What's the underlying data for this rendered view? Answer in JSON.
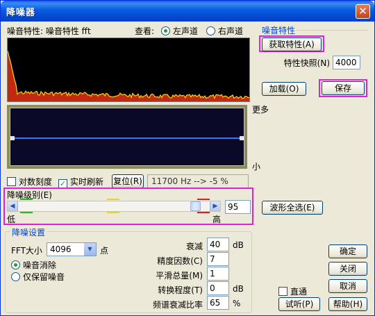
{
  "window": {
    "title": "降噪器",
    "close_glyph": "✕"
  },
  "noise_profile_header": {
    "label": "噪音特性: 噪音特性 fft"
  },
  "view": {
    "label": "查看:",
    "left_channel": "左声道",
    "right_channel": "右声道",
    "selected": "左声道"
  },
  "profile_group": {
    "title": "噪音特性",
    "get_profile": "获取特性(A)",
    "snapshots_label": "特性快照(N)",
    "snapshots_value": "4000",
    "load": "加载(O)",
    "save": "保存"
  },
  "graph": {
    "more": "更多",
    "less": "小"
  },
  "options": {
    "log_scale": "对数刻度",
    "log_scale_checked": false,
    "live_update": "实时刷新",
    "live_update_checked": true,
    "reset": "复位(R)",
    "readout": "11700 Hz --> -5 %"
  },
  "noise_level": {
    "label": "降噪级别(E)",
    "value": "95",
    "fraction": 0.95,
    "low": "低",
    "high": "高",
    "marker_colors": [
      "#19c119",
      "#e8d810",
      "#e02020"
    ]
  },
  "select_all": "波形全选(E)",
  "settings": {
    "title": "降噪设置",
    "fft_label": "FFT大小",
    "fft_value": "4096",
    "fft_unit": "点",
    "remove_noise": "噪音消除",
    "keep_noise": "仅保留噪音",
    "mode_selected": "噪音消除",
    "params": [
      {
        "label": "衰减",
        "value": "40",
        "unit": "dB"
      },
      {
        "label": "精度因数(C)",
        "value": "7",
        "unit": ""
      },
      {
        "label": "平滑总量(M)",
        "value": "1",
        "unit": ""
      },
      {
        "label": "转换程度(T)",
        "value": "0",
        "unit": "dB"
      },
      {
        "label": "频谱衰减比率",
        "value": "65",
        "unit": "%"
      }
    ]
  },
  "bypass": {
    "label": "直通",
    "checked": false
  },
  "buttons": {
    "ok": "确定",
    "close": "关闭",
    "cancel": "取消",
    "preview": "试听(P)",
    "help": "帮助(H)"
  },
  "colors": {
    "accent": "#0046d5",
    "highlight": "#e020d8",
    "graph_bg": "#000000",
    "curve": "#3a78ff"
  }
}
